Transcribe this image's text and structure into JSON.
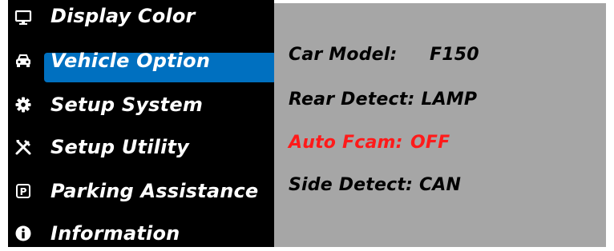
{
  "colors": {
    "sidebar_bg": "#000000",
    "content_bg": "#a6a6a6",
    "highlight": "#0070c0",
    "menu_text": "#ffffff",
    "option_text": "#000000",
    "selected_option_text": "#ff1a1a"
  },
  "menu": {
    "selected": "Vehicle Option",
    "items": [
      {
        "label": "Display Color",
        "icon": "monitor-icon"
      },
      {
        "label": "Vehicle Option",
        "icon": "car-icon"
      },
      {
        "label": "Setup System",
        "icon": "gear-icon"
      },
      {
        "label": "Setup Utility",
        "icon": "tools-icon"
      },
      {
        "label": "Parking Assistance",
        "icon": "parking-icon"
      },
      {
        "label": "Information",
        "icon": "info-icon"
      }
    ]
  },
  "options": [
    {
      "key": "Car Model:",
      "value": "F150"
    },
    {
      "key": "Rear Detect:",
      "value": "LAMP"
    },
    {
      "key": "Auto Fcam:",
      "value": "OFF",
      "selected": true
    },
    {
      "key": "Side Detect:",
      "value": "CAN"
    }
  ]
}
